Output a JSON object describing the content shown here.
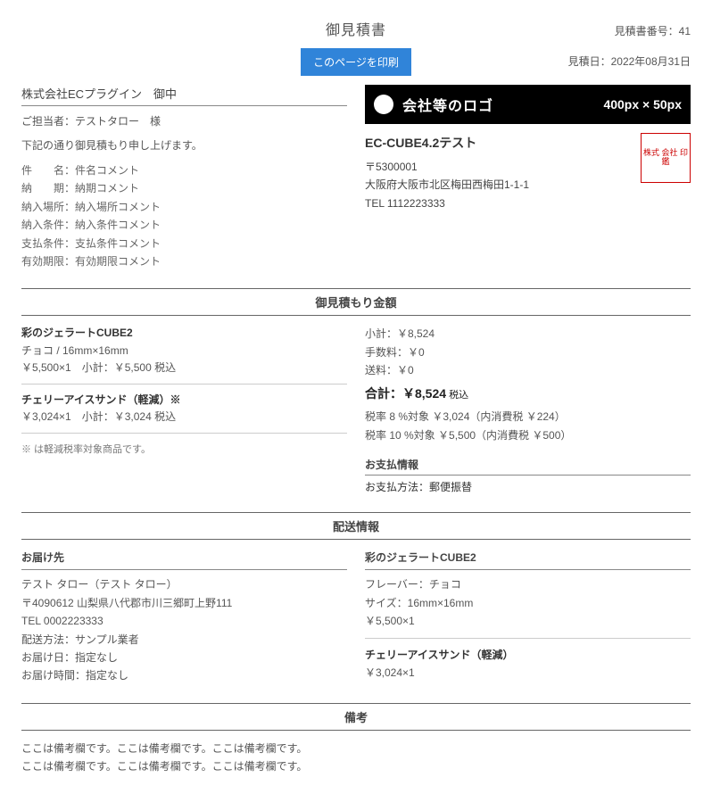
{
  "header": {
    "title": "御見積書",
    "quote_no_label": "見積書番号：",
    "quote_no": "41",
    "print_button": "このページを印刷",
    "quote_date_label": "見積日：",
    "quote_date": "2022年08月31日"
  },
  "customer": {
    "name": "株式会社ECプラグイン　御中",
    "contact": "ご担当者：テストタロー　様",
    "intro": "下記の通り御見積もり申し上げます。",
    "meta": {
      "subject_label": "件　　名：",
      "subject": "件名コメント",
      "delivery_label": "納　　期：",
      "delivery": "納期コメント",
      "place_label": "納入場所：",
      "place": "納入場所コメント",
      "condition_label": "納入条件：",
      "condition": "納入条件コメント",
      "payment_label": "支払条件：",
      "payment": "支払条件コメント",
      "validity_label": "有効期限：",
      "validity": "有効期限コメント"
    }
  },
  "company": {
    "logo_text": "会社等のロゴ",
    "logo_dim": "400px × 50px",
    "name": "EC-CUBE4.2テスト",
    "postal": "〒5300001",
    "address": "大阪府大阪市北区梅田西梅田1-1-1",
    "tel": "TEL 1112223333",
    "seal_text": "株式\n会社\n印鑑"
  },
  "amount": {
    "section_title": "御見積もり金額",
    "items": [
      {
        "name": "彩のジェラートCUBE2",
        "spec": "チョコ / 16mm×16mm",
        "line": "￥5,500×1　小計：￥5,500 税込"
      },
      {
        "name": "チェリーアイスサンド（軽減）※",
        "spec": "",
        "line": "￥3,024×1　小計：￥3,024 税込"
      }
    ],
    "footnote": "※ は軽減税率対象商品です。",
    "totals": {
      "subtotal": "小計：￥8,524",
      "fee": "手数料：￥0",
      "shipping": "送料：￥0",
      "grand_label": "合計：",
      "grand_value": "￥8,524",
      "grand_suffix": " 税込",
      "tax8": "税率 8 %対象 ￥3,024（内消費税 ￥224）",
      "tax10": "税率 10 %対象 ￥5,500（内消費税 ￥500）"
    },
    "payment_info": {
      "head": "お支払情報",
      "line": "お支払方法：郵便振替"
    }
  },
  "shipping": {
    "section_title": "配送情報",
    "dest": {
      "head": "お届け先",
      "name": "テスト タロー（テスト タロー）",
      "postal_addr": "〒4090612 山梨県八代郡市川三郷町上野111",
      "tel": "TEL 0002223333",
      "method": "配送方法：サンプル業者",
      "date": "お届け日：指定なし",
      "time": "お届け時間：指定なし"
    },
    "items": [
      {
        "name": "彩のジェラートCUBE2",
        "flavor": "フレーバー：チョコ",
        "size": "サイズ：16mm×16mm",
        "line": "￥5,500×1"
      },
      {
        "name": "チェリーアイスサンド（軽減）",
        "flavor": "",
        "size": "",
        "line": "￥3,024×1"
      }
    ]
  },
  "remarks": {
    "section_title": "備考",
    "line1": "ここは備考欄です。ここは備考欄です。ここは備考欄です。",
    "line2": "ここは備考欄です。ここは備考欄です。ここは備考欄です。"
  }
}
